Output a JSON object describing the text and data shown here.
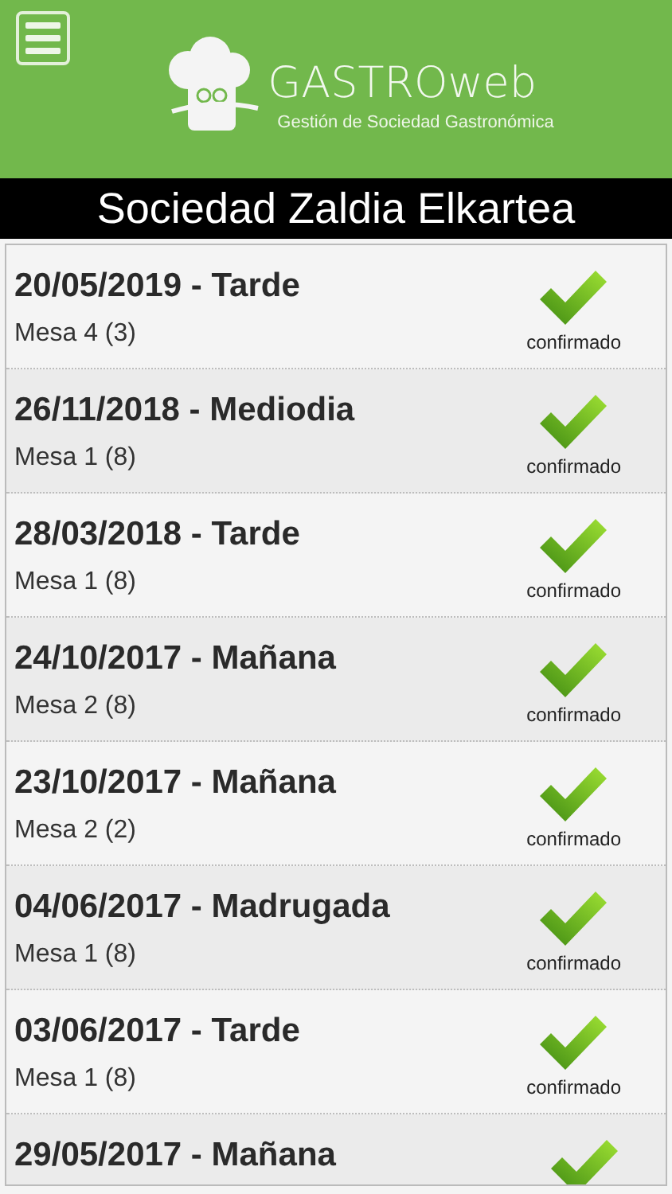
{
  "header": {
    "brand": "GASTROweb",
    "tagline": "Gestión de Sociedad Gastronómica"
  },
  "title": "Sociedad Zaldia Elkartea",
  "reservations": [
    {
      "title": "20/05/2019 - Tarde",
      "table": "Mesa 4 (3)",
      "status": "confirmado",
      "confirmed": true
    },
    {
      "title": "26/11/2018 - Mediodia",
      "table": "Mesa 1 (8)",
      "status": "confirmado",
      "confirmed": true
    },
    {
      "title": "28/03/2018 - Tarde",
      "table": "Mesa 1 (8)",
      "status": "confirmado",
      "confirmed": true
    },
    {
      "title": "24/10/2017 - Mañana",
      "table": "Mesa 2 (8)",
      "status": "confirmado",
      "confirmed": true
    },
    {
      "title": "23/10/2017 - Mañana",
      "table": "Mesa 2 (2)",
      "status": "confirmado",
      "confirmed": true
    },
    {
      "title": "04/06/2017 - Madrugada",
      "table": "Mesa 1 (8)",
      "status": "confirmado",
      "confirmed": true
    },
    {
      "title": "03/06/2017 - Tarde",
      "table": "Mesa 1 (8)",
      "status": "confirmado",
      "confirmed": true
    },
    {
      "title": "29/05/2017 - Mañana",
      "confirmed": true
    }
  ]
}
